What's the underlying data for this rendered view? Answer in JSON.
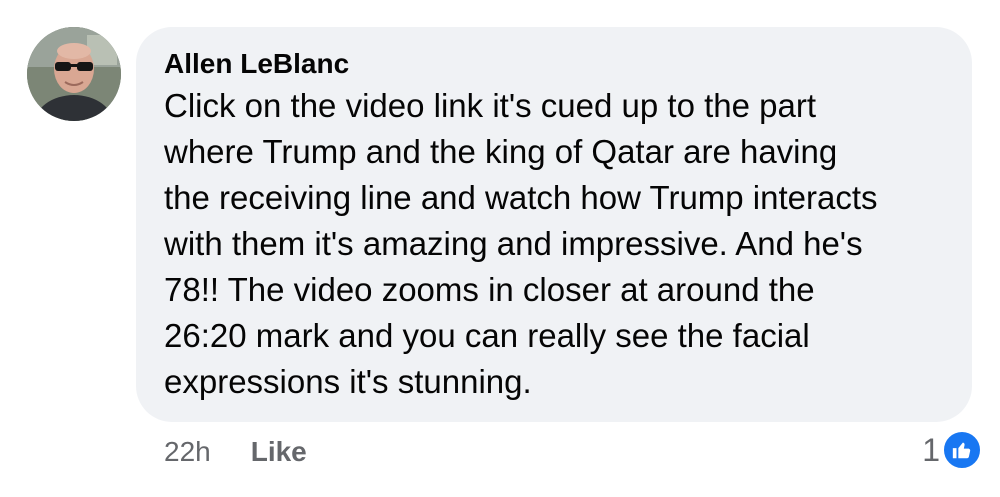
{
  "comment": {
    "author": "Allen LeBlanc",
    "text": "Click on the video link it's cued up to the part\nwhere Trump and the king of Qatar are having\nthe receiving line and watch how Trump interacts\nwith them it's amazing and impressive. And he's\n78!! The video zooms in closer at around the\n26:20 mark and you can really see the facial\nexpressions it's stunning.",
    "timestamp": "22h",
    "like_label": "Like",
    "reaction_count": "1",
    "reaction_icon": "like-thumbs-up-icon"
  },
  "colors": {
    "bubble_bg": "#f0f2f5",
    "accent": "#1877f2",
    "secondary_text": "#65676b"
  }
}
